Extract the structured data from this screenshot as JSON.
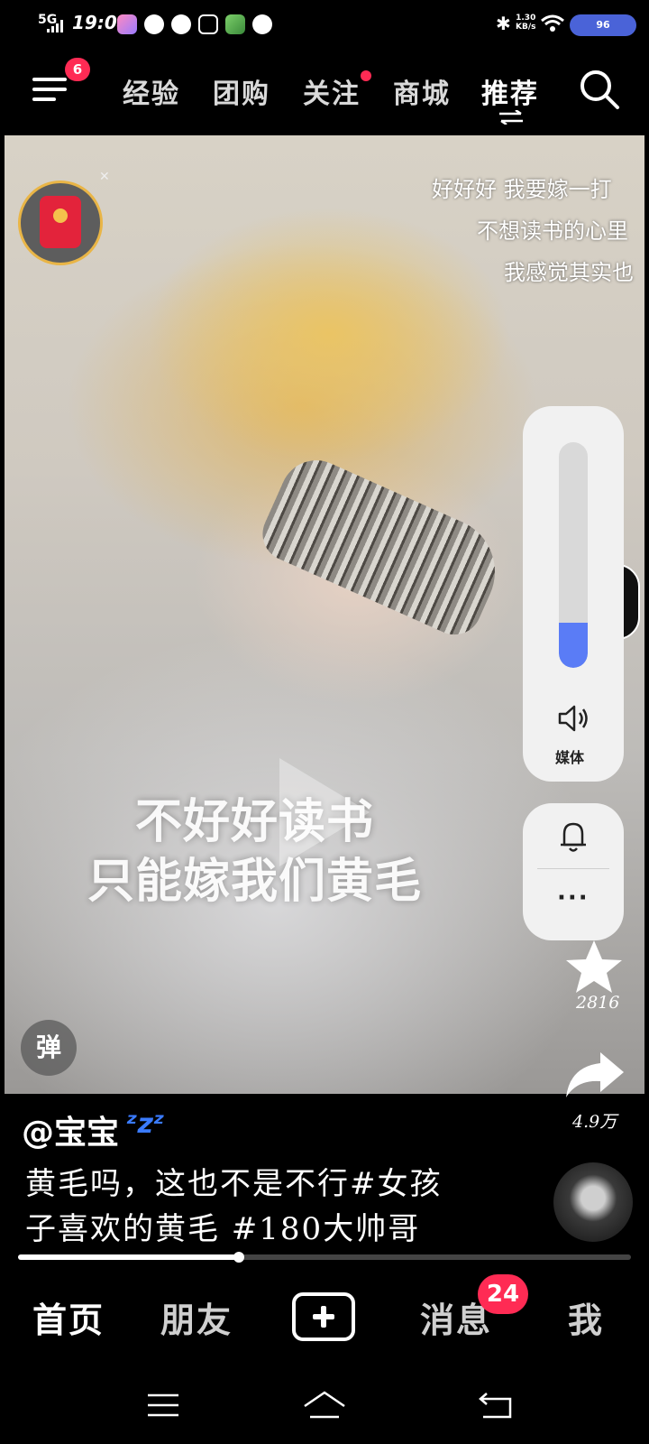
{
  "status_bar": {
    "network": "5G",
    "time": "19:04",
    "speed": "1.30\nKB/s",
    "speed_value": "1.30",
    "speed_unit": "KB/s",
    "battery": "96"
  },
  "top_nav": {
    "menu_badge": "6",
    "tabs": [
      "经验",
      "团购",
      "关注",
      "商城",
      "推荐"
    ],
    "active_tab": "推荐"
  },
  "video": {
    "overlay_lines": [
      "好好好 我要嫁一打",
      "不想读书的心里",
      "我感觉其实也"
    ],
    "subtitle_lines": [
      "不好好读书",
      "只能嫁我们黄毛"
    ],
    "danmaku_label": "弹"
  },
  "volume_panel": {
    "level": 0.2,
    "label": "媒体"
  },
  "actions": {
    "favorite_count": "2816",
    "share_count": "4.9万"
  },
  "post": {
    "author": "@宝宝",
    "author_emoji": "ᶻzᶻ",
    "caption_lines": [
      "黄毛吗，这也不是不行#女孩",
      "子喜欢的黄毛 #180大帅哥"
    ],
    "progress": 0.36
  },
  "bottom_nav": {
    "items": [
      "首页",
      "朋友",
      "消息",
      "我"
    ],
    "message_badge": "24"
  },
  "colors": {
    "badge": "#ff2b54",
    "battery": "#4a63d8",
    "volume_fill": "#5a7cf6"
  }
}
